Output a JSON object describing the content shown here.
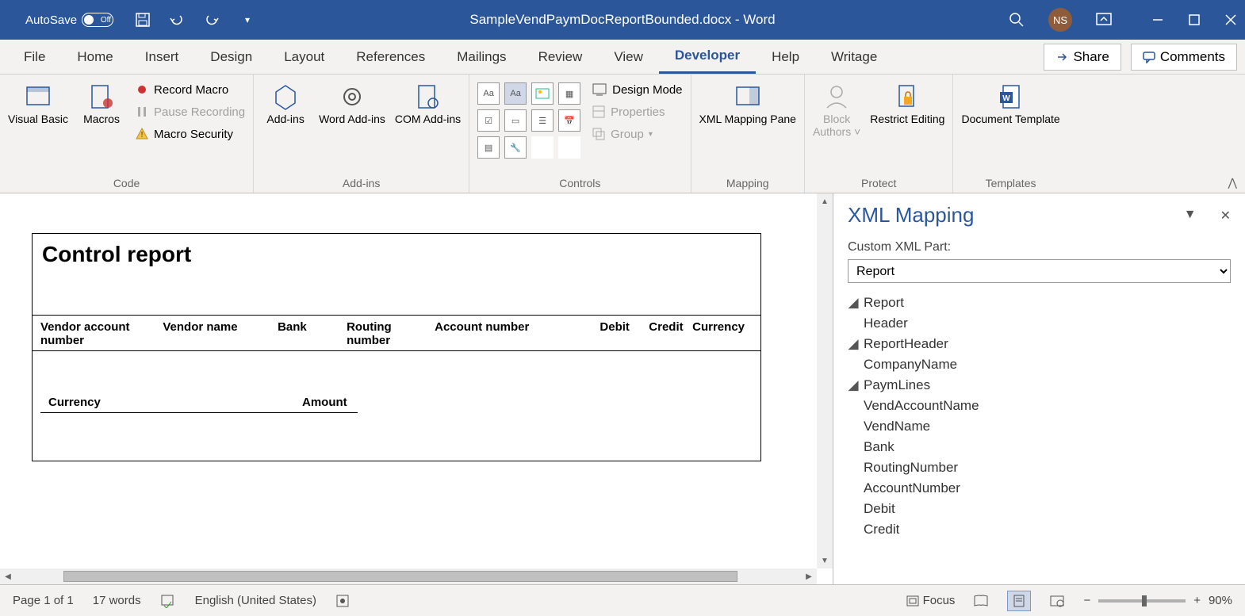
{
  "titlebar": {
    "autosave_label": "AutoSave",
    "autosave_state": "Off",
    "doc_title": "SampleVendPaymDocReportBounded.docx - Word",
    "avatar": "NS"
  },
  "tabs": {
    "items": [
      "File",
      "Home",
      "Insert",
      "Design",
      "Layout",
      "References",
      "Mailings",
      "Review",
      "View",
      "Developer",
      "Help",
      "Writage"
    ],
    "active": "Developer",
    "share": "Share",
    "comments": "Comments"
  },
  "ribbon": {
    "code": {
      "visual_basic": "Visual Basic",
      "macros": "Macros",
      "record_macro": "Record Macro",
      "pause_recording": "Pause Recording",
      "macro_security": "Macro Security",
      "label": "Code"
    },
    "addins": {
      "addins": "Add-ins",
      "word_addins": "Word Add-ins",
      "com_addins": "COM Add-ins",
      "label": "Add-ins"
    },
    "controls": {
      "design_mode": "Design Mode",
      "properties": "Properties",
      "group": "Group",
      "label": "Controls"
    },
    "mapping": {
      "xml_mapping_pane": "XML Mapping Pane",
      "label": "Mapping"
    },
    "protect": {
      "block_authors": "Block Authors",
      "restrict_editing": "Restrict Editing",
      "label": "Protect"
    },
    "templates": {
      "document_template": "Document Template",
      "label": "Templates"
    }
  },
  "document": {
    "title": "Control report",
    "columns": [
      "Vendor account number",
      "Vendor name",
      "Bank",
      "Routing number",
      "Account number",
      "Debit",
      "Credit",
      "Currency"
    ],
    "summary_cols": [
      "Currency",
      "Amount"
    ]
  },
  "xml_pane": {
    "title": "XML Mapping",
    "custom_label": "Custom XML Part:",
    "selected": "Report",
    "tree": {
      "root": "Report",
      "children": [
        {
          "name": "Header"
        },
        {
          "name": "ReportHeader",
          "expanded": true,
          "children": [
            {
              "name": "CompanyName"
            }
          ]
        },
        {
          "name": "PaymLines",
          "expanded": true,
          "children": [
            {
              "name": "VendAccountName"
            },
            {
              "name": "VendName"
            },
            {
              "name": "Bank"
            },
            {
              "name": "RoutingNumber"
            },
            {
              "name": "AccountNumber"
            },
            {
              "name": "Debit"
            },
            {
              "name": "Credit"
            }
          ]
        }
      ]
    }
  },
  "statusbar": {
    "page": "Page 1 of 1",
    "words": "17 words",
    "language": "English (United States)",
    "focus": "Focus",
    "zoom": "90%"
  }
}
